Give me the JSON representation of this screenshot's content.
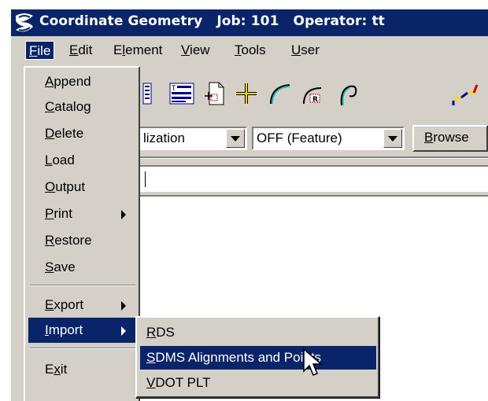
{
  "window": {
    "title": "Coordinate Geometry   Job: 101   Operator: tt",
    "icon": "app-logo-icon"
  },
  "menubar": {
    "items": [
      {
        "label": "File",
        "mnemonic": "F",
        "rest": "ile",
        "active": true
      },
      {
        "label": "Edit",
        "mnemonic": "E",
        "rest": "dit"
      },
      {
        "label": "Element",
        "pre": "E",
        "mnemonic": "l",
        "rest": "ement"
      },
      {
        "label": "View",
        "mnemonic": "V",
        "rest": "iew"
      },
      {
        "label": "Tools",
        "mnemonic": "T",
        "rest": "ools"
      },
      {
        "label": "User",
        "mnemonic": "U",
        "rest": "ser"
      }
    ]
  },
  "toolbar": {
    "icons": [
      "list-icon",
      "text-list-icon",
      "document-add-icon",
      "crosshair-icon",
      "arc-icon",
      "arc-radius-icon",
      "spiral-icon",
      "alignment-icon"
    ]
  },
  "combos": {
    "visualization_value": "lization",
    "feature_value": "OFF (Feature)",
    "browse_label": "Browse",
    "browse_mnemonic": "B",
    "browse_rest": "rowse"
  },
  "file_menu": {
    "items": [
      {
        "m": "A",
        "r": "ppend"
      },
      {
        "m": "C",
        "r": "atalog"
      },
      {
        "m": "D",
        "r": "elete"
      },
      {
        "m": "L",
        "r": "oad"
      },
      {
        "m": "O",
        "r": "utput"
      },
      {
        "m": "P",
        "r": "rint",
        "submenu": true
      },
      {
        "m": "R",
        "r": "estore"
      },
      {
        "m": "S",
        "r": "ave"
      },
      {
        "m": "E",
        "r": "xport",
        "submenu": true
      },
      {
        "m": "I",
        "r": "mport",
        "submenu": true,
        "active": true
      },
      {
        "pre": "E",
        "m": "x",
        "r": "it"
      }
    ]
  },
  "import_submenu": {
    "items": [
      {
        "m": "R",
        "r": "DS"
      },
      {
        "m": "S",
        "r": "DMS Alignments and Points",
        "active": true
      },
      {
        "m": "V",
        "r": "DOT PLT"
      }
    ]
  },
  "colors": {
    "titlebar_bg": "#0a246a",
    "selection_bg": "#0a246a",
    "face": "#d4d0c8"
  }
}
